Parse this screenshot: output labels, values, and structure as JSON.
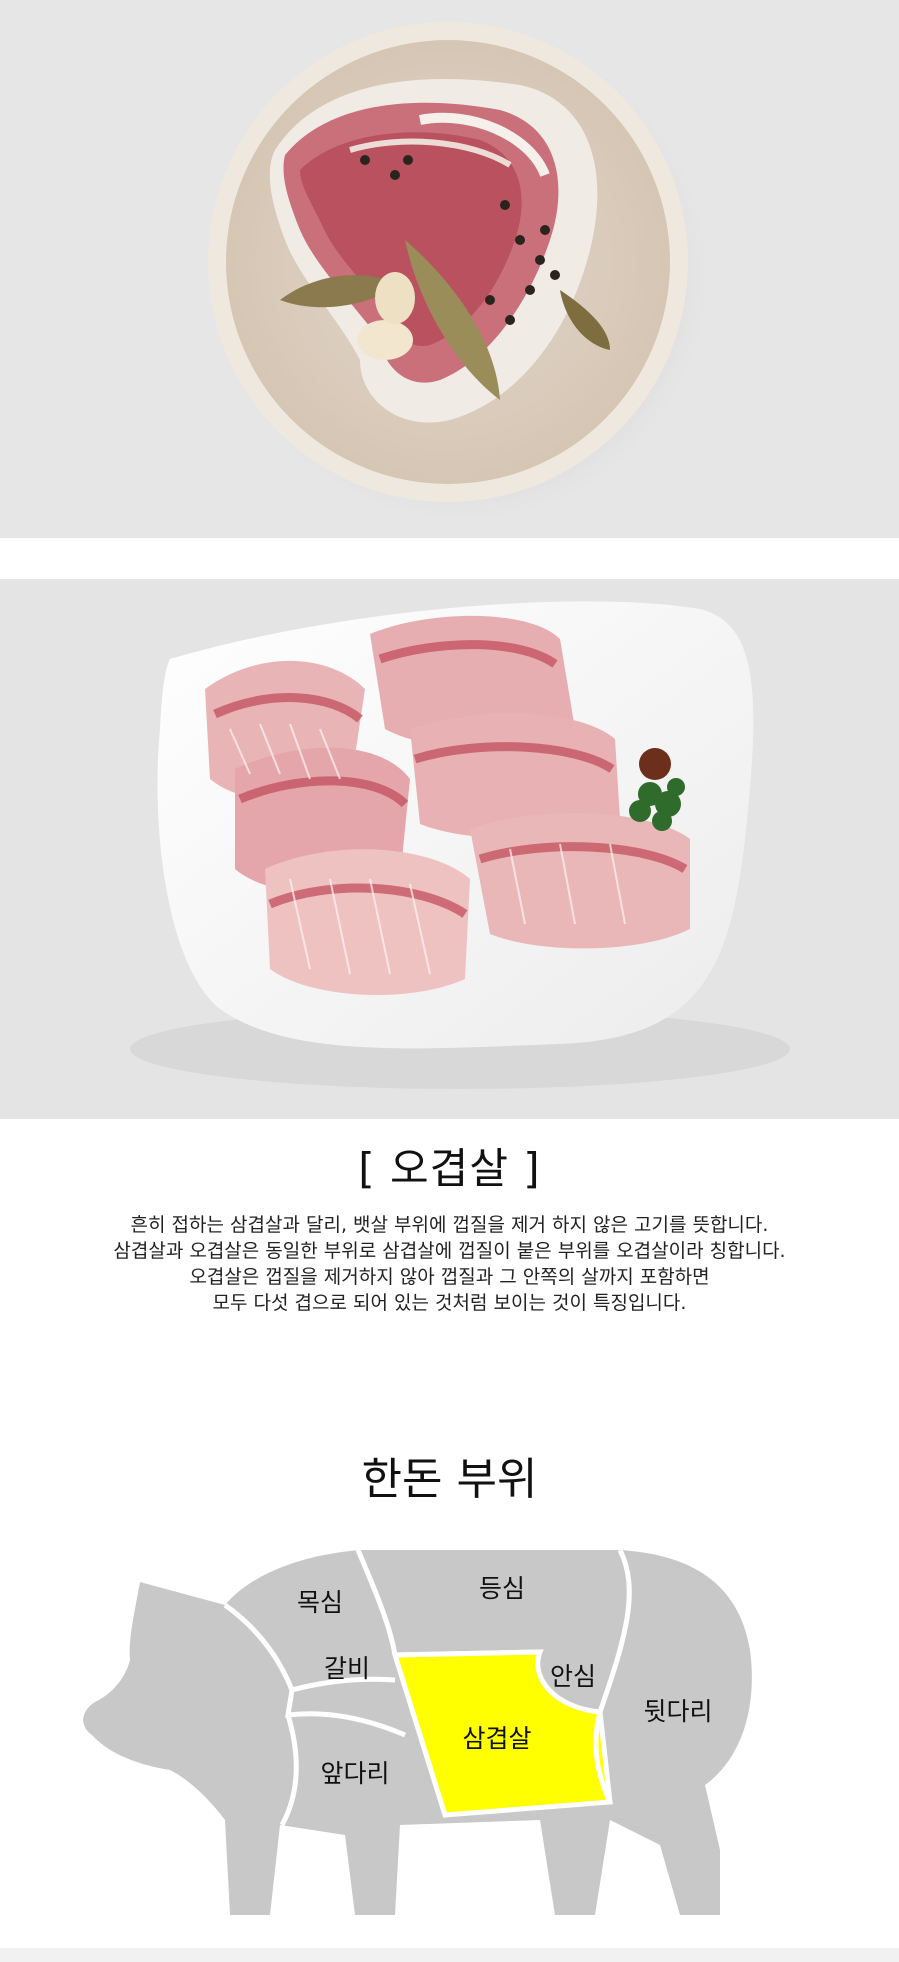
{
  "product": {
    "cut_title": "[ 오겹살 ]",
    "description": [
      "흔히 접하는 삼겹살과 달리, 뱃살 부위에 껍질을 제거 하지 않은 고기를 뜻합니다.",
      "삼겹살과 오겹살은 동일한 부위로 삼겹살에 껍질이 붙은 부위를 오겹살이라 칭합니다.",
      "오겹살은 껍질을 제거하지 않아 껍질과 그 안쪽의 살까지 포함하면",
      "모두 다섯 겹으로 되어 있는 것처럼 보이는 것이 특징입니다."
    ]
  },
  "parts_section": {
    "title": "한돈 부위",
    "cuts": {
      "moksim": "목심",
      "deungsim": "등심",
      "galbi": "갈비",
      "ansim": "안심",
      "samgyeopsal": "삼겹살",
      "apdari": "앞다리",
      "dwitdari": "뒷다리"
    },
    "highlighted_cut": "삼겹살"
  },
  "colors": {
    "photo_background": "#e6e6e6",
    "pig_body": "#c8c8c8",
    "highlight": "#ffff00",
    "divider": "#ffffff"
  }
}
